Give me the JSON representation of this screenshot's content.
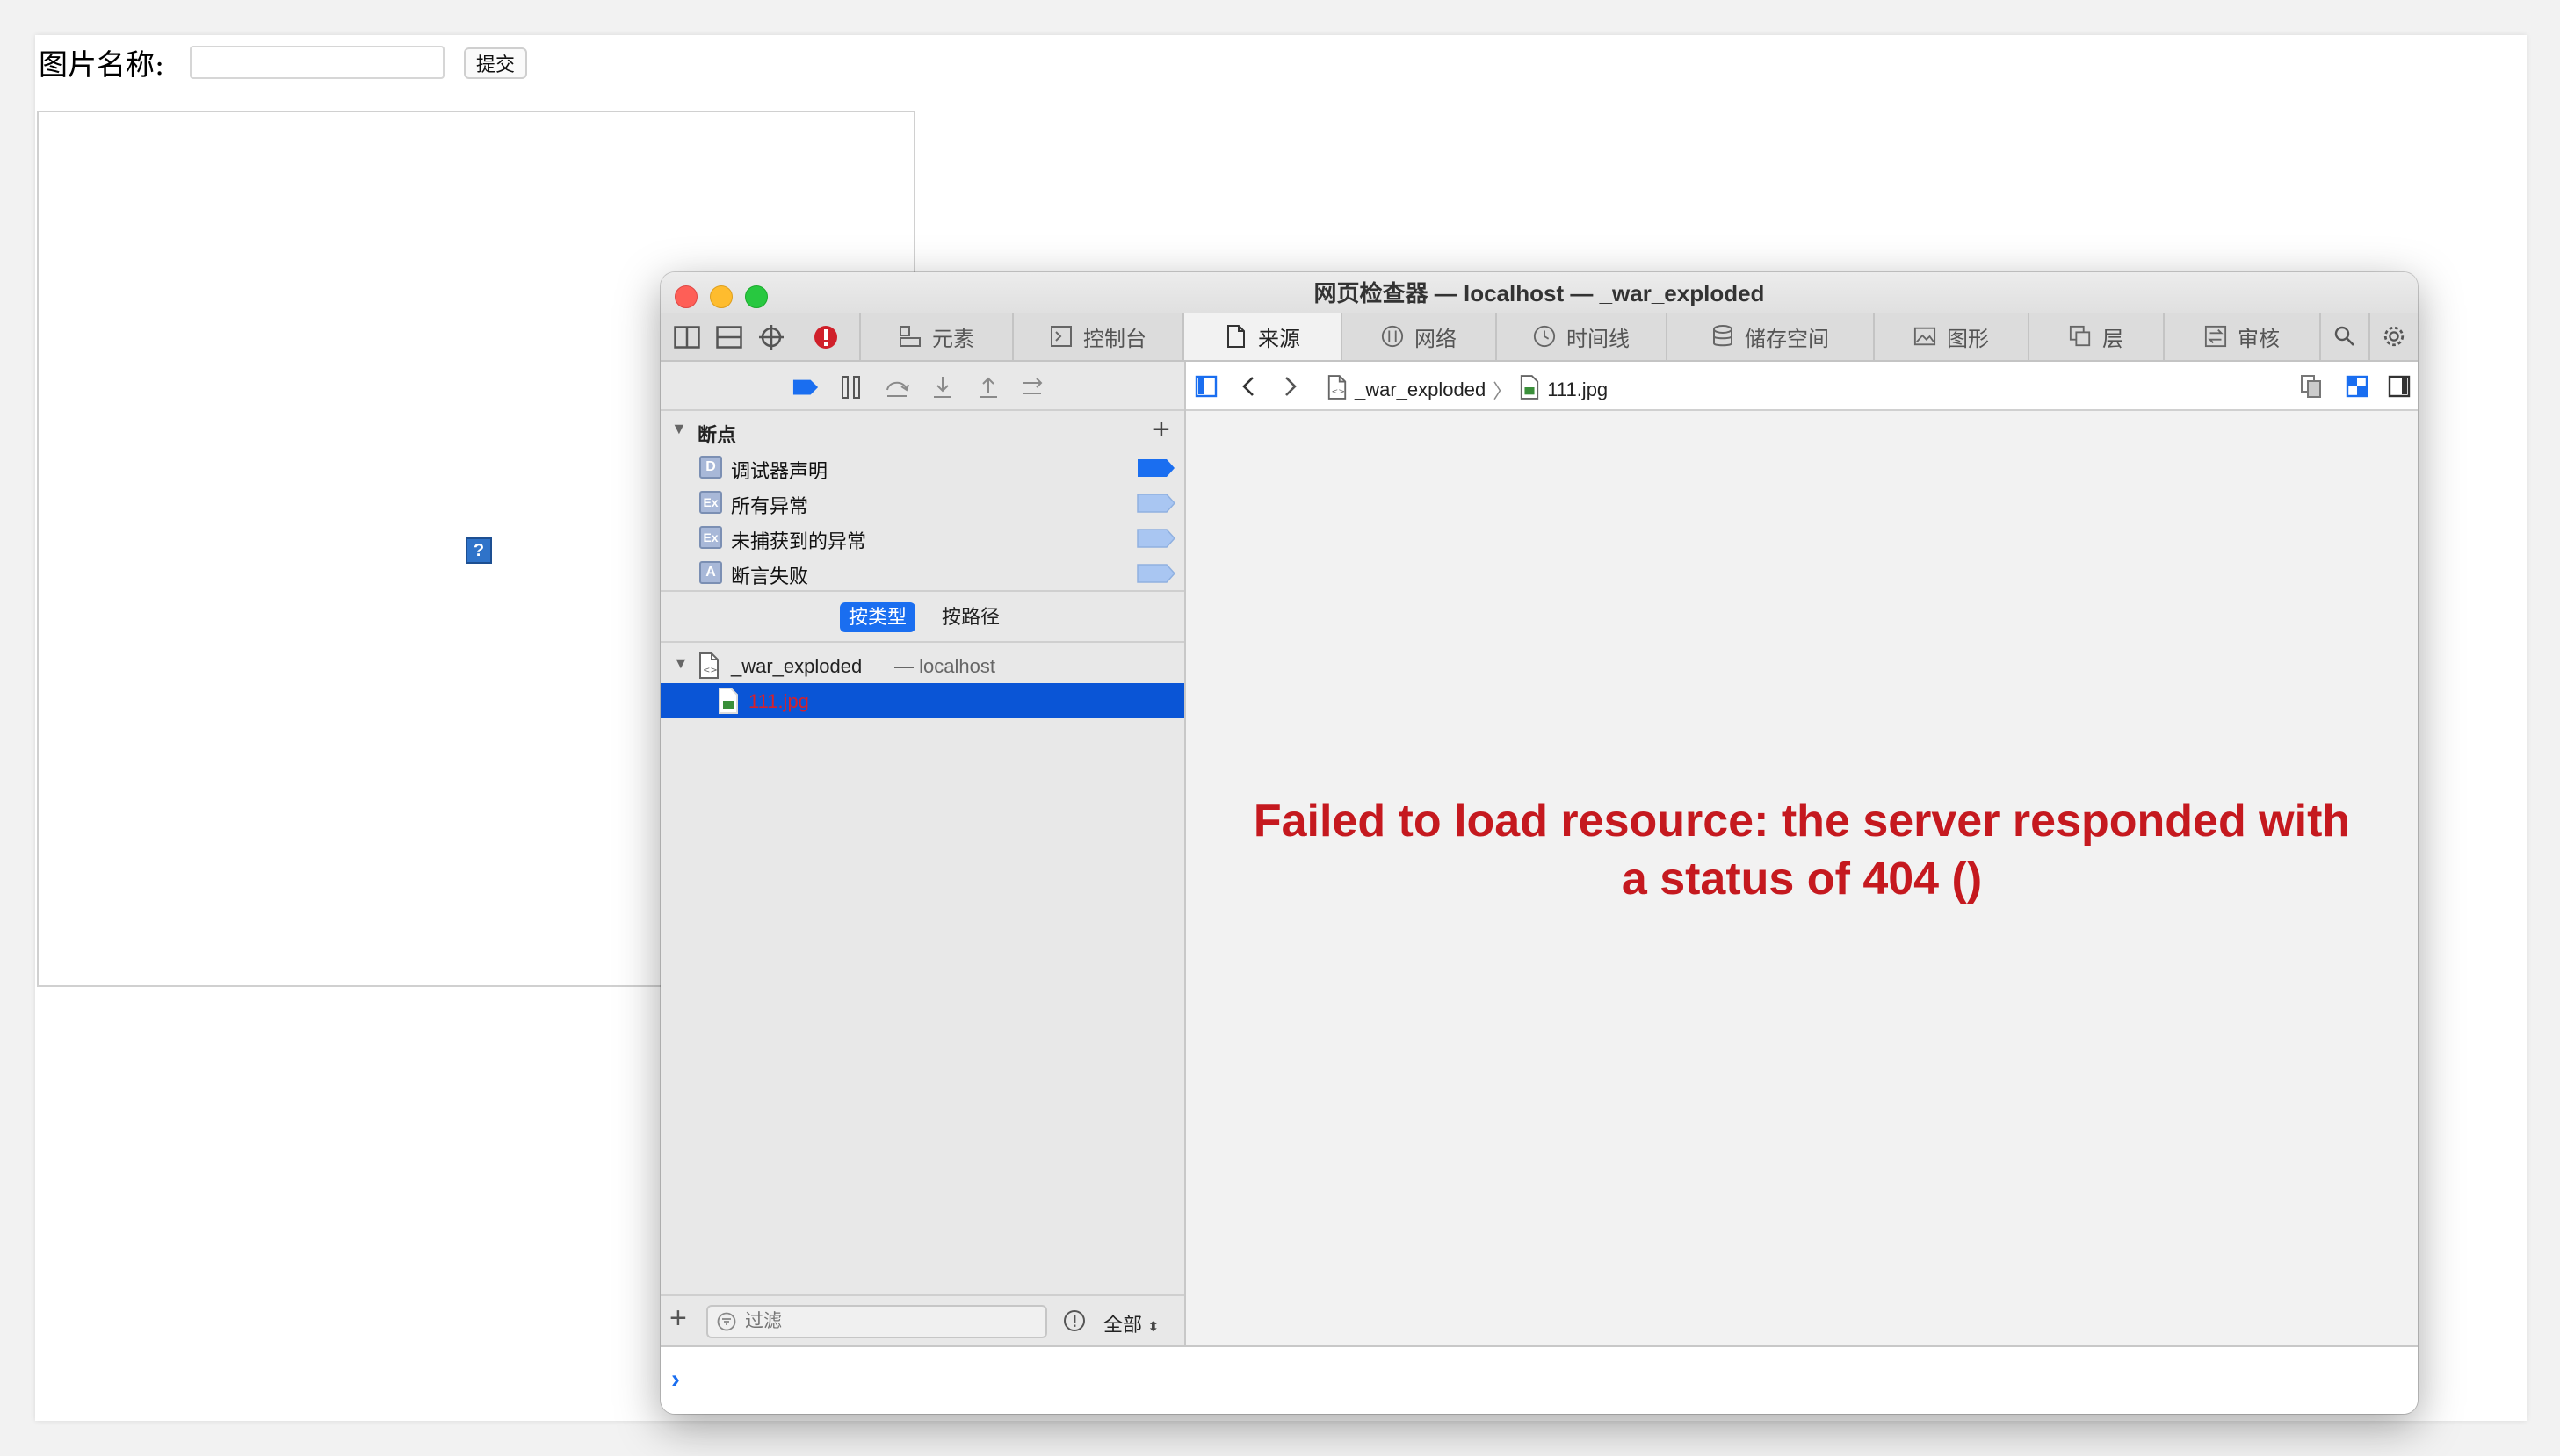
{
  "page": {
    "form_label": "图片名称:",
    "form_input_value": "",
    "submit_label": "提交",
    "broken_image_glyph": "?"
  },
  "inspector": {
    "title": "网页检查器 — localhost — _war_exploded",
    "tabs": [
      {
        "label": "元素",
        "icon": "elements-icon",
        "active": false
      },
      {
        "label": "控制台",
        "icon": "console-icon",
        "active": false
      },
      {
        "label": "来源",
        "icon": "document-icon",
        "active": true
      },
      {
        "label": "网络",
        "icon": "network-icon",
        "active": false
      },
      {
        "label": "时间线",
        "icon": "clock-icon",
        "active": false
      },
      {
        "label": "储存空间",
        "icon": "database-icon",
        "active": false
      },
      {
        "label": "图形",
        "icon": "image-icon",
        "active": false
      },
      {
        "label": "层",
        "icon": "layers-icon",
        "active": false
      },
      {
        "label": "审核",
        "icon": "audit-icon",
        "active": false
      }
    ],
    "breakpoints": {
      "header": "断点",
      "items": [
        {
          "badge": "D",
          "label": "调试器声明",
          "enabled": true
        },
        {
          "badge": "Ex",
          "label": "所有异常",
          "enabled": false
        },
        {
          "badge": "Ex",
          "label": "未捕获到的异常",
          "enabled": false
        },
        {
          "badge": "A",
          "label": "断言失败",
          "enabled": false
        }
      ]
    },
    "grouping": {
      "by_type": "按类型",
      "by_path": "按路径"
    },
    "tree": {
      "root_name": "_war_exploded",
      "root_host": "— localhost",
      "child": "111.jpg"
    },
    "filter": {
      "placeholder": "过滤",
      "scope": "全部"
    },
    "breadcrumb": {
      "folder": "_war_exploded",
      "file": "111.jpg"
    },
    "error": {
      "line1": "Failed to load resource: the server responded with",
      "line2": "a status of 404 ()"
    },
    "console_prompt": "›"
  },
  "colors": {
    "accent_blue": "#1a6ef0",
    "selection_blue": "#0a55d6",
    "error_red": "#c5191f",
    "close_red": "#fe5f57",
    "minimize_yellow": "#febc2e",
    "zoom_green": "#28c840"
  }
}
